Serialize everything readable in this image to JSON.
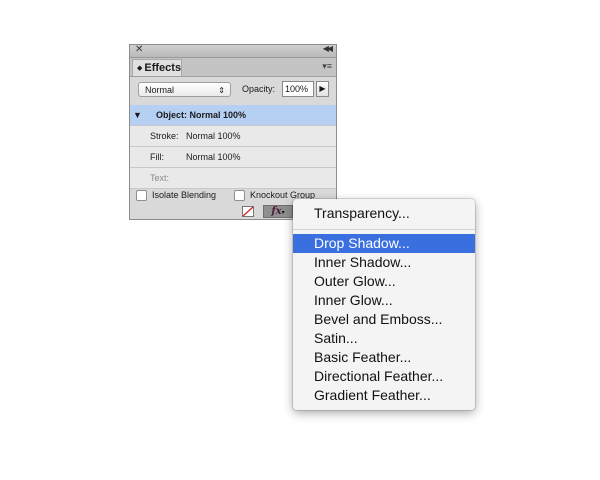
{
  "panel": {
    "title": "Effects",
    "blend_mode": "Normal",
    "opacity_label": "Opacity:",
    "opacity_value": "100%",
    "rows": [
      {
        "label": "Object:",
        "value": "Normal 100%",
        "selected": true
      },
      {
        "label": "Stroke:",
        "value": "Normal 100%"
      },
      {
        "label": "Fill:",
        "value": "Normal 100%"
      },
      {
        "label": "Text:",
        "value": ""
      }
    ],
    "isolate_blending": "Isolate Blending",
    "knockout_group": "Knockout Group",
    "fx_button": "fx"
  },
  "menu": {
    "items": [
      "Transparency...",
      "Drop Shadow...",
      "Inner Shadow...",
      "Outer Glow...",
      "Inner Glow...",
      "Bevel and Emboss...",
      "Satin...",
      "Basic Feather...",
      "Directional Feather...",
      "Gradient Feather..."
    ],
    "highlighted_index": 1
  },
  "colors": {
    "selection_row": "#b6d0f4",
    "menu_highlight": "#3a6fe0"
  }
}
